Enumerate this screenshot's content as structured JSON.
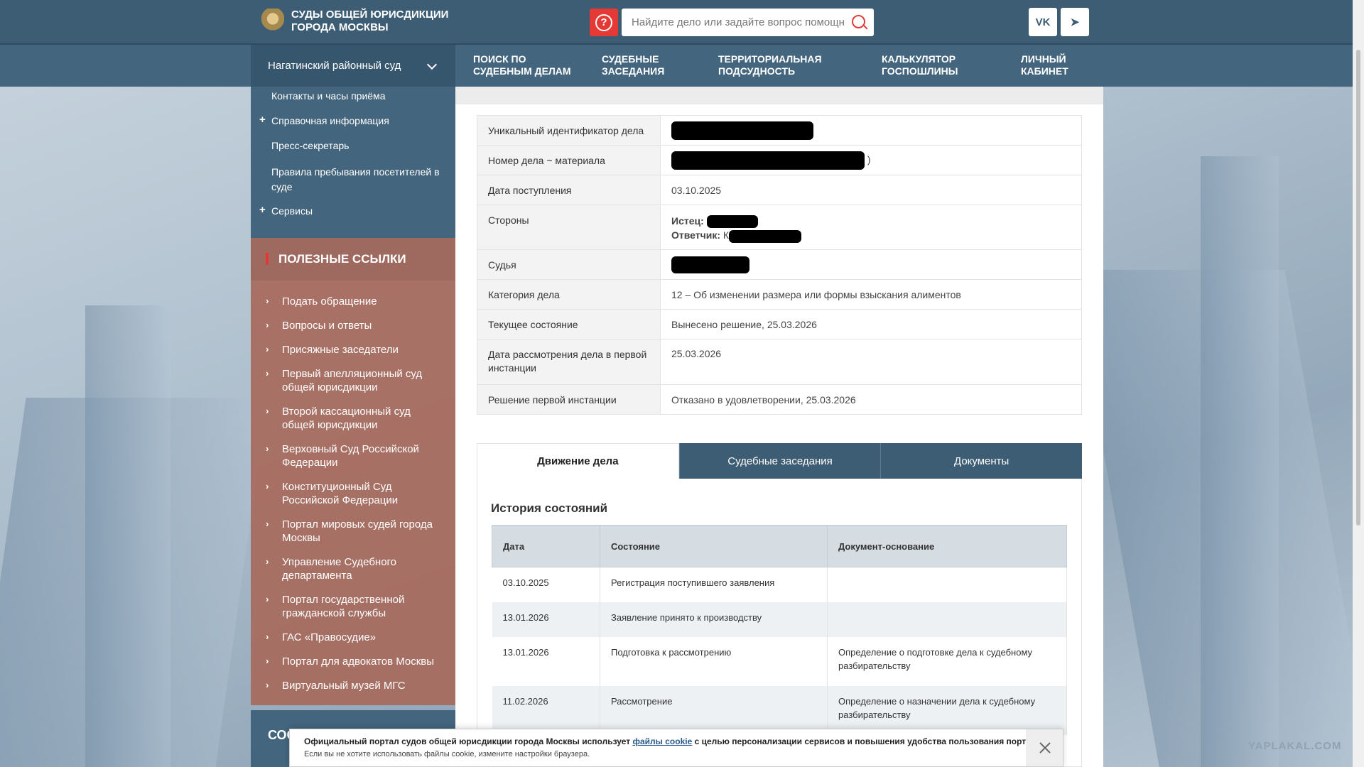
{
  "header": {
    "logo_line1": "СУДЫ ОБЩЕЙ ЮРИСДИКЦИИ",
    "logo_line2": "ГОРОДА МОСКВЫ",
    "help_icon": "?",
    "search_placeholder": "Найдите дело или задайте вопрос помощнику",
    "vk_label": "VK",
    "telegram_label": "➤"
  },
  "nav": {
    "court": "Нагатинский районный суд",
    "items": [
      {
        "line1": "ПОИСК ПО",
        "line2": "СУДЕБНЫМ ДЕЛАМ"
      },
      {
        "line1": "СУДЕБНЫЕ",
        "line2": "ЗАСЕДАНИЯ"
      },
      {
        "line1": "ТЕРРИТОРИАЛЬНАЯ",
        "line2": "ПОДСУДНОСТЬ"
      },
      {
        "line1": "КАЛЬКУЛЯТОР",
        "line2": "ГОСПОШЛИНЫ"
      },
      {
        "line1": "ЛИЧНЫЙ",
        "line2": "КАБИНЕТ"
      }
    ]
  },
  "sidebar": {
    "links": [
      "Контакты и часы приёма",
      "Справочная информация",
      "Пресс-секретарь",
      "Правила пребывания посетителей в суде",
      "Сервисы"
    ],
    "useful_title": "ПОЛЕЗНЫЕ ССЫЛКИ",
    "useful_links": [
      "Подать обращение",
      "Вопросы и ответы",
      "Присяжные заседатели",
      "Первый апелляционный суд общей юрисдикции",
      "Второй кассационный суд общей юрисдикции",
      "Верховный Суд Российской Федерации",
      "Конституционный Суд Российской Федерации",
      "Портал мировых судей города Москвы",
      "Управление Судебного департамента",
      "Портал государственной гражданской службы",
      "ГАС «Правосудие»",
      "Портал для адвокатов Москвы",
      "Виртуальный музей МГС"
    ],
    "bottom_text": "СОО ТЕХ ПРО"
  },
  "case": {
    "rows": [
      {
        "label": "Уникальный идентификатор дела",
        "value": ""
      },
      {
        "label": "Номер дела ~ материала",
        "value": ")"
      },
      {
        "label": "Дата поступления",
        "value": "03.10.2025"
      },
      {
        "label": "Стороны",
        "plaintiff_label": "Истец:",
        "defendant_label": "Ответчик:",
        "defendant_prefix": "К"
      },
      {
        "label": "Судья",
        "value": ""
      },
      {
        "label": "Категория дела",
        "value": "12 – Об изменении размера или формы взыскания алиментов"
      },
      {
        "label": "Текущее состояние",
        "value": "Вынесено решение, 25.03.2026"
      },
      {
        "label": "Дата рассмотрения дела в первой инстанции",
        "value": "25.03.2026"
      },
      {
        "label": "Решение первой инстанции",
        "value": "Отказано в удовлетворении, 25.03.2026"
      }
    ]
  },
  "tabs": [
    "Движение дела",
    "Судебные заседания",
    "Документы"
  ],
  "history": {
    "title": "История состояний",
    "columns": [
      "Дата",
      "Состояние",
      "Документ-основание"
    ],
    "rows": [
      {
        "date": "03.10.2025",
        "state": "Регистрация поступившего заявления",
        "doc": ""
      },
      {
        "date": "13.01.2026",
        "state": "Заявление принято к производству",
        "doc": ""
      },
      {
        "date": "13.01.2026",
        "state": "Подготовка к рассмотрению",
        "doc": "Определение о подготовке дела к судебному разбирательству"
      },
      {
        "date": "11.02.2026",
        "state": "Рассмотрение",
        "doc": "Определение о назначении дела к судебному разбирательству"
      }
    ]
  },
  "cookie": {
    "text_before": "Официальный портал судов общей юрисдикции города Москвы использует ",
    "link": "файлы cookie",
    "text_after": " с целью персонализации сервисов и повышения удобства пользования порталом.",
    "line2": "Если вы не хотите использовать файлы cookie, измените настройки браузера."
  },
  "watermark": "YAPLAKAL.COM",
  "colors": {
    "header": "#3d5d74",
    "nav": "#43657d",
    "useful": "#9e6a5f",
    "accent": "#e53935"
  }
}
